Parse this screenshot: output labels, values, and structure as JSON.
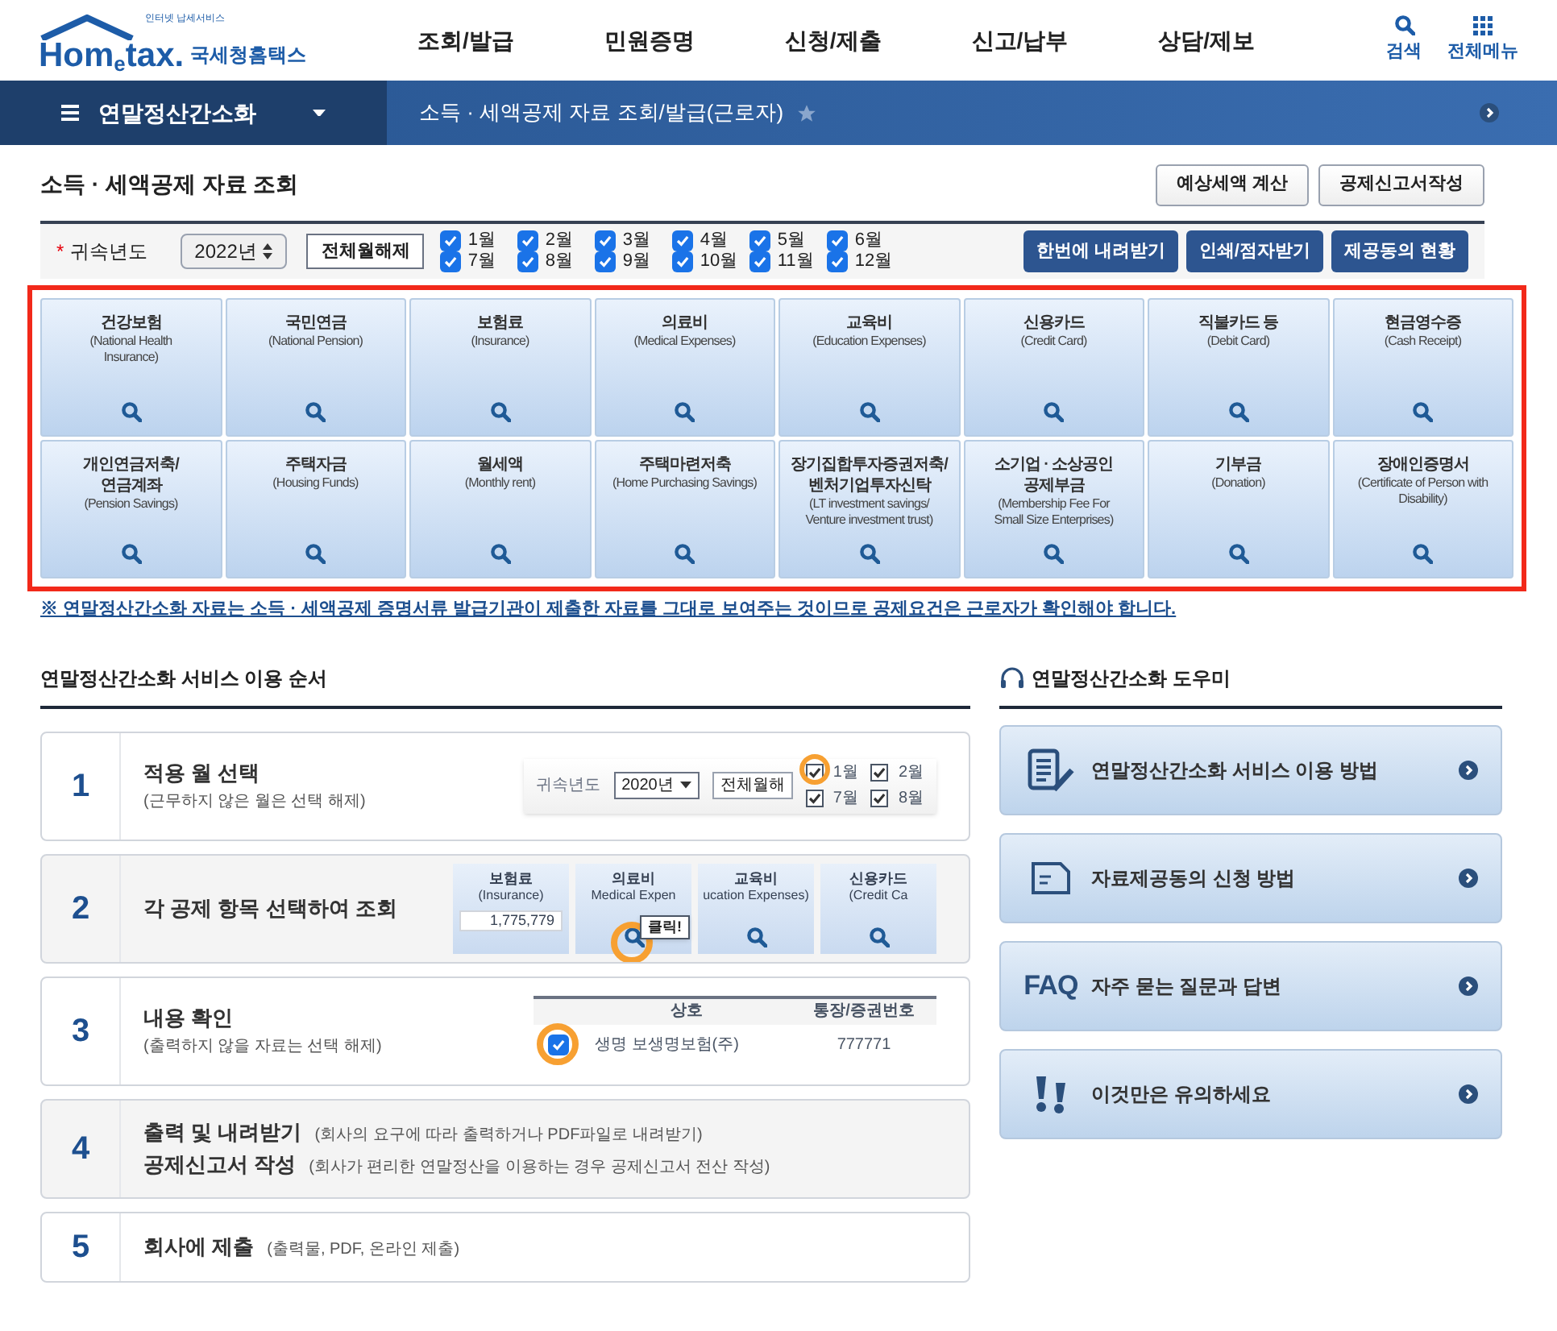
{
  "logo": {
    "tagline": "인터넷 납세서비스",
    "brand_a": "Hom",
    "brand_e": "e",
    "brand_b": "tax.",
    "org": "국세청홈택스"
  },
  "top_menu": [
    "조회/발급",
    "민원증명",
    "신청/제출",
    "신고/납부",
    "상담/제보"
  ],
  "top_tools": [
    {
      "kind": "search",
      "label": "검색"
    },
    {
      "kind": "menu",
      "label": "전체메뉴"
    }
  ],
  "nav": {
    "menu_title": "연말정산간소화",
    "breadcrumb": "소득 · 세액공제 자료 조회/발급(근로자)",
    "favorite": false
  },
  "page_title": "소득 · 세액공제 자료 조회",
  "title_buttons": [
    "예상세액 계산",
    "공제신고서작성"
  ],
  "filter": {
    "required_mark": "*",
    "label": "귀속년도",
    "year": "2022년",
    "clear_button": "전체월해제",
    "months": [
      {
        "label": "1월",
        "checked": true
      },
      {
        "label": "2월",
        "checked": true
      },
      {
        "label": "3월",
        "checked": true
      },
      {
        "label": "4월",
        "checked": true
      },
      {
        "label": "5월",
        "checked": true
      },
      {
        "label": "6월",
        "checked": true
      },
      {
        "label": "7월",
        "checked": true
      },
      {
        "label": "8월",
        "checked": true
      },
      {
        "label": "9월",
        "checked": true
      },
      {
        "label": "10월",
        "checked": true
      },
      {
        "label": "11월",
        "checked": true
      },
      {
        "label": "12월",
        "checked": true
      }
    ],
    "actions": [
      "한번에 내려받기",
      "인쇄/점자받기",
      "제공동의 현황"
    ]
  },
  "categories": [
    {
      "title_lines": [
        "건강보험"
      ],
      "subtitle_lines": [
        "(National Health",
        "Insurance)"
      ]
    },
    {
      "title_lines": [
        "국민연금"
      ],
      "subtitle_lines": [
        "(National Pension)"
      ]
    },
    {
      "title_lines": [
        "보험료"
      ],
      "subtitle_lines": [
        "(Insurance)"
      ]
    },
    {
      "title_lines": [
        "의료비"
      ],
      "subtitle_lines": [
        "(Medical Expenses)"
      ]
    },
    {
      "title_lines": [
        "교육비"
      ],
      "subtitle_lines": [
        "(Education Expenses)"
      ]
    },
    {
      "title_lines": [
        "신용카드"
      ],
      "subtitle_lines": [
        "(Credit Card)"
      ]
    },
    {
      "title_lines": [
        "직불카드 등"
      ],
      "subtitle_lines": [
        "(Debit Card)"
      ]
    },
    {
      "title_lines": [
        "현금영수증"
      ],
      "subtitle_lines": [
        "(Cash Receipt)"
      ]
    },
    {
      "title_lines": [
        "개인연금저축/",
        "연금계좌"
      ],
      "subtitle_lines": [
        "(Pension Savings)"
      ]
    },
    {
      "title_lines": [
        "주택자금"
      ],
      "subtitle_lines": [
        "(Housing Funds)"
      ]
    },
    {
      "title_lines": [
        "월세액"
      ],
      "subtitle_lines": [
        "(Monthly rent)"
      ]
    },
    {
      "title_lines": [
        "주택마련저축"
      ],
      "subtitle_lines": [
        "(Home Purchasing Savings)"
      ]
    },
    {
      "title_lines": [
        "장기집합투자증권저축/",
        "벤처기업투자신탁"
      ],
      "subtitle_lines": [
        "(LT investment savings/",
        "Venture investment trust)"
      ]
    },
    {
      "title_lines": [
        "소기업 · 소상공인",
        "공제부금"
      ],
      "subtitle_lines": [
        "(Membership Fee For",
        "Small Size Enterprises)"
      ]
    },
    {
      "title_lines": [
        "기부금"
      ],
      "subtitle_lines": [
        "(Donation)"
      ]
    },
    {
      "title_lines": [
        "장애인증명서"
      ],
      "subtitle_lines": [
        "(Certificate of Person with",
        "Disability)"
      ]
    }
  ],
  "notice": "※ 연말정산간소화 자료는 소득 · 세액공제 증명서류 발급기관이 제출한 자료를 그대로 보여주는 것이므로 공제요건은 근로자가 확인해야 합니다.",
  "steps_heading": "연말정산간소화 서비스 이용 순서",
  "steps": [
    {
      "number": "1",
      "kind": "months",
      "lines": [
        {
          "title": "적용 월 선택",
          "note": "(근무하지 않은 월은 선택 해제)"
        }
      ],
      "sample": {
        "label": "귀속년도",
        "year": "2020년",
        "button": "전체월해",
        "months": [
          {
            "label": "1월",
            "checked": true
          },
          {
            "label": "7월",
            "checked": true
          },
          {
            "label": "2월",
            "checked": true
          },
          {
            "label": "8월",
            "checked": true
          }
        ]
      }
    },
    {
      "number": "2",
      "kind": "cards",
      "lines": [
        {
          "title": "각 공제 항목 선택하여 조회"
        }
      ],
      "sample": {
        "cards": [
          {
            "title": "보험료",
            "subtitle": "(Insurance)",
            "amount": "1,775,779"
          },
          {
            "title": "의료비",
            "subtitle": "Medical Expen"
          },
          {
            "title": "교육비",
            "subtitle": "ucation Expenses)"
          },
          {
            "title": "신용카드",
            "subtitle": "(Credit Ca"
          }
        ],
        "tooltip": "클릭!"
      }
    },
    {
      "number": "3",
      "kind": "table",
      "lines": [
        {
          "title": "내용 확인",
          "note": "(출력하지 않을 자료는 선택 해제)"
        }
      ],
      "sample": {
        "columns": [
          "상호",
          "통장/증권번호"
        ],
        "rows": [
          {
            "checked": true,
            "company": "생명 보생명보험(주)",
            "account": "777771"
          }
        ]
      }
    },
    {
      "number": "4",
      "kind": "text",
      "lines": [
        {
          "title": "출력 및 내려받기",
          "inline_note": "(회사의 요구에 따라 출력하거나 PDF파일로 내려받기)"
        },
        {
          "title": "공제신고서 작성",
          "inline_note": "(회사가 편리한 연말정산을 이용하는 경우 공제신고서 전산 작성)"
        }
      ]
    },
    {
      "number": "5",
      "kind": "text",
      "lines": [
        {
          "title": "회사에 제출",
          "inline_note": "(출력물, PDF, 온라인 제출)"
        }
      ]
    }
  ],
  "helper_heading": "연말정산간소화 도우미",
  "helper_items": [
    {
      "kind": "document",
      "label": "연말정산간소화 서비스 이용 방법"
    },
    {
      "kind": "form",
      "label": "자료제공동의 신청 방법"
    },
    {
      "kind": "faq",
      "badge": "FAQ",
      "label": "자주 묻는 질문과 답변"
    },
    {
      "kind": "warning",
      "label": "이것만은 유의하세요"
    }
  ]
}
